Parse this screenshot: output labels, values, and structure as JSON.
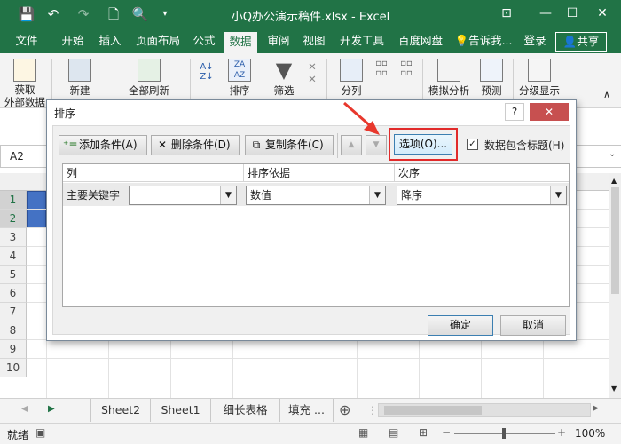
{
  "window": {
    "title": "小Q办公演示稿件.xlsx - Excel"
  },
  "quick_access": {
    "save": "💾",
    "undo": "↶",
    "redo": "↷",
    "new": "🗋",
    "preview": "🔍"
  },
  "window_controls": {
    "ribbon_options": "⊡",
    "minimize": "—",
    "maximize": "☐",
    "close": "✕"
  },
  "menu": {
    "tabs": [
      "文件",
      "开始",
      "插入",
      "页面布局",
      "公式",
      "数据",
      "审阅",
      "视图",
      "开发工具",
      "百度网盘"
    ],
    "active_tab": "数据",
    "tell_me": "告诉我...",
    "login": "登录",
    "share": "共享"
  },
  "ribbon": {
    "buttons": [
      {
        "label": "获取\n外部数据"
      },
      {
        "label": "新建"
      },
      {
        "label": "全部刷新"
      },
      {
        "label": "排序"
      },
      {
        "label": "筛选"
      },
      {
        "label": "分列"
      },
      {
        "label": "模拟分析"
      },
      {
        "label": "预测"
      },
      {
        "label": "分级显示"
      }
    ]
  },
  "formula_bar": {
    "name_box": "A2",
    "value": ""
  },
  "grid": {
    "rows": [
      "1",
      "2",
      "3",
      "4",
      "5",
      "6",
      "7",
      "8",
      "9",
      "10"
    ],
    "selected_rows": [
      "1",
      "2"
    ]
  },
  "sheet_tabs": {
    "tabs": [
      "Sheet2",
      "Sheet1",
      "细长表格",
      "填充 ..."
    ],
    "add": "⊕"
  },
  "status_bar": {
    "ready": "就绪",
    "zoom": "100%"
  },
  "dialog": {
    "title": "排序",
    "help": "?",
    "close": "✕",
    "add_condition": "添加条件(A)",
    "delete_condition": "删除条件(D)",
    "copy_condition": "复制条件(C)",
    "move_up": "▲",
    "move_down": "▼",
    "options": "选项(O)...",
    "has_header": "数据包含标题(H)",
    "has_header_checked": true,
    "columns": {
      "column": "列",
      "sort_on": "排序依据",
      "order": "次序"
    },
    "row": {
      "key_label": "主要关键字",
      "key_value": "",
      "sort_on_value": "数值",
      "order_value": "降序"
    },
    "ok": "确定",
    "cancel": "取消"
  },
  "colors": {
    "excel_green": "#217346",
    "highlight_red": "#e12a2a",
    "arrow_red": "#e8382d",
    "selection_blue": "#4472c4"
  }
}
